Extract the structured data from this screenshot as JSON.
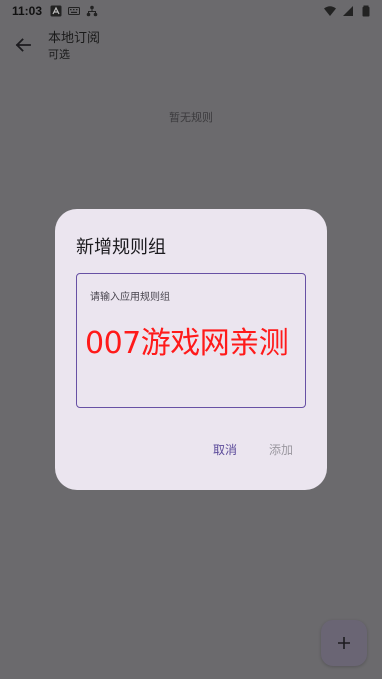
{
  "status_bar": {
    "time": "11:03"
  },
  "app_bar": {
    "title": "本地订阅",
    "subtitle": "可选"
  },
  "empty_state": {
    "text": "暂无规则"
  },
  "dialog": {
    "title": "新增规则组",
    "input_placeholder": "请输入应用规则组",
    "overlay_text": "007游戏网亲测",
    "cancel_label": "取消",
    "add_label": "添加"
  },
  "fab": {
    "icon": "plus-icon"
  },
  "colors": {
    "accent": "#6750a4",
    "dialog_bg": "#ebe5ef",
    "scrim": "#6b6a6d",
    "overlay_text": "#ff1a1a"
  }
}
